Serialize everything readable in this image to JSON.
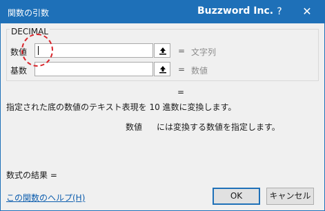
{
  "window": {
    "title": "関数の引数",
    "watermark": "Buzzword Inc.",
    "help_label": "?",
    "close_label": "✕"
  },
  "function_group": {
    "name": "DECIMAL",
    "args": [
      {
        "label": "数値",
        "value": "",
        "equals": "=",
        "hint": "文字列"
      },
      {
        "label": "基数",
        "value": "",
        "equals": "=",
        "hint": "数値"
      }
    ]
  },
  "result_equals": "=",
  "description": "指定された底の数値のテキスト表現を 10 進数に変換します。",
  "arg_description": {
    "name": "数値",
    "text": "には変換する数値を指定します。"
  },
  "formula_result": "数式の結果 =",
  "help_link": "この関数のヘルプ(H)",
  "buttons": {
    "ok": "OK",
    "cancel": "キャンセル"
  },
  "colors": {
    "title_bar": "#1e70b8",
    "annotation": "#d9262c",
    "link": "#0b5cad"
  },
  "icons": {
    "collapse": "collapse-dialog-icon"
  }
}
